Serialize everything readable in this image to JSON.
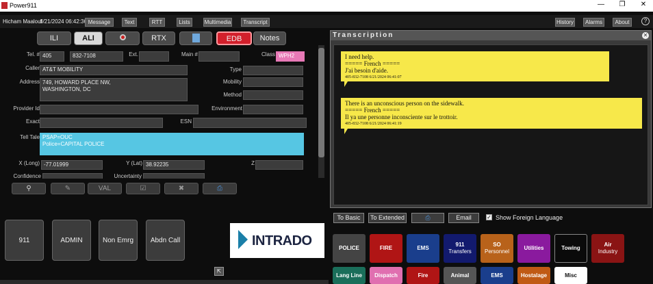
{
  "window": {
    "title": "Power911"
  },
  "menubar": {
    "user": "Hicham Maalouf",
    "datetime": "6/21/2024 06:42:36",
    "left_items": [
      "Message",
      "Text",
      "RTT",
      "Lists",
      "Multimedia",
      "Transcript"
    ],
    "right_items": [
      "History",
      "Alarms",
      "About"
    ]
  },
  "tabs": [
    "ILI",
    "ALI",
    "RTX",
    "EDB",
    "Notes"
  ],
  "ali": {
    "tel_label": "Tel. #",
    "tel_area": "405",
    "tel_number": "832-7108",
    "ext_label": "Ext.",
    "main_label": "Main #",
    "class_label": "Class",
    "class_value": "WPH2",
    "caller_label": "Caller",
    "caller_value": "AT&T MOBILITY",
    "type_label": "Type",
    "address_label": "Address",
    "address_value": "749, HOWARD PLACE NW,\nWASHINGTON, DC",
    "mobility_label": "Mobility",
    "method_label": "Method",
    "provider_label": "Provider Id",
    "environment_label": "Environment",
    "exact_label": "Exact",
    "esn_label": "ESN",
    "telltale_label": "Tell Tale",
    "telltale_value": "PSAP=OUC\nPolice=CAPITAL POLICE",
    "long_label": "X (Long)",
    "long_value": "-77.01999",
    "lat_label": "Y (Lat)",
    "lat_value": "38.92235",
    "z_label": "Z",
    "confidence_label": "Confidence",
    "uncertainty_label": "Uncertainty"
  },
  "tools": {
    "val_label": "VAL"
  },
  "bigbuttons": [
    "911",
    "ADMIN",
    "Non Emrg",
    "Abdn Call"
  ],
  "logo": {
    "text": "INTRADO"
  },
  "transcription": {
    "title": "Transcription",
    "messages": [
      {
        "line1": "I need help.",
        "line2": "===== French =====",
        "line3": "J'ai besoin d'aide.",
        "ts": "405-832-7108 6/21/2024 06:41:07"
      },
      {
        "line1": "There is an unconscious person on the sidewalk.",
        "line2": "===== French =====",
        "line3": "Il ya une personne inconsciente sur le trottoir.",
        "ts": "405-832-7108 6/21/2024 06:41:19"
      }
    ],
    "buttons": {
      "basic": "To Basic",
      "extended": "To Extended",
      "email": "Email"
    },
    "foreign_label": "Show Foreign Language"
  },
  "categories": [
    {
      "label": "POLICE",
      "sub": "",
      "color": "#444444"
    },
    {
      "label": "FIRE",
      "sub": "",
      "color": "#b01515"
    },
    {
      "label": "EMS",
      "sub": "",
      "color": "#1a3e8c"
    },
    {
      "label": "911",
      "sub": "Transfers",
      "color": "#121a6e"
    },
    {
      "label": "SO",
      "sub": "Personnel",
      "color": "#b8621a"
    },
    {
      "label": "Utilities",
      "sub": "",
      "color": "#8a1a9e"
    },
    {
      "label": "Towing",
      "sub": "",
      "color": "#0a0a0a"
    },
    {
      "label": "Air",
      "sub": "Industry",
      "color": "#8a1414"
    },
    {
      "label": "Lang Line",
      "sub": "",
      "color": "#1a6e5a"
    },
    {
      "label": "Dispatch",
      "sub": "",
      "color": "#e06fb0"
    },
    {
      "label": "Fire",
      "sub": "",
      "color": "#b01515"
    },
    {
      "label": "Animal",
      "sub": "",
      "color": "#555555"
    },
    {
      "label": "EMS",
      "sub": "",
      "color": "#1a3e8c"
    },
    {
      "label": "Hostalage",
      "sub": "",
      "color": "#c05a14"
    },
    {
      "label": "Misc",
      "sub": "",
      "color": "#ffffff"
    }
  ]
}
